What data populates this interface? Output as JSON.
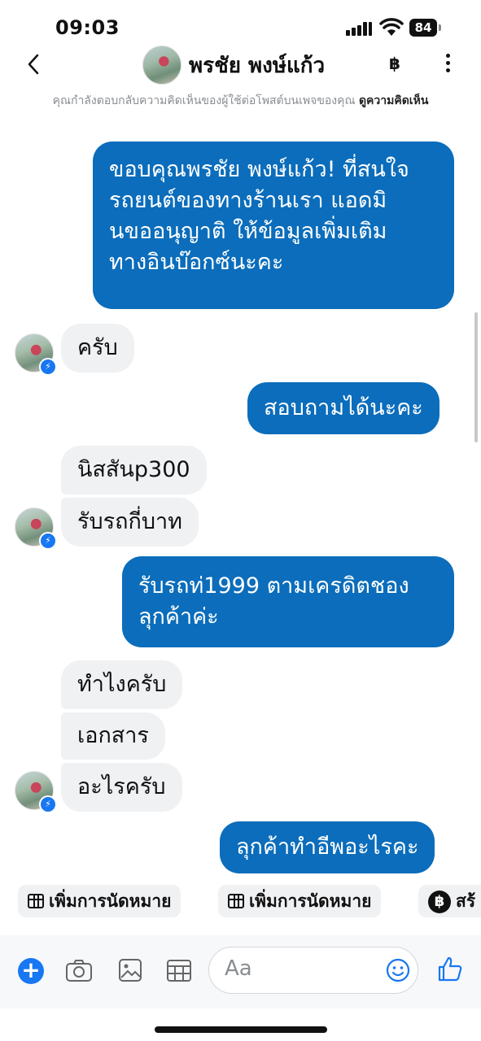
{
  "status_bar": {
    "time": "09:03",
    "battery": "84"
  },
  "header": {
    "contact_name": "พรชัย พงษ์แก้ว",
    "notice_text": "คุณกำลังตอบกลับความคิดเห็นของผู้ใช้ต่อโพสต์บนเพจของคุณ",
    "notice_link": "ดูความคิดเห็น"
  },
  "messages": [
    {
      "side": "out",
      "lines": [
        "ขอบคุณพรชัย พงษ์แก้ว! ที่สนใจ",
        "รถยนต์ของทางร้านเรา แอดมิ",
        "นขออนุญาติ ให้ข้อมูลเพิ่มเติม",
        "ทางอินบ๊อกซ์นะคะ"
      ]
    },
    {
      "side": "in",
      "text": "ครับ"
    },
    {
      "side": "out",
      "text": "สอบถามได้นะคะ"
    },
    {
      "side": "in",
      "text": "นิสสันp300"
    },
    {
      "side": "in",
      "text": "รับรถกี่บาท"
    },
    {
      "side": "out",
      "lines": [
        "รับรถท่1999 ตามเครดิตชอง",
        "ลุกค้าค่ะ"
      ]
    },
    {
      "side": "in",
      "text": "ทำไงครับ"
    },
    {
      "side": "in",
      "text": "เอกสาร"
    },
    {
      "side": "in",
      "text": "อะไรครับ"
    },
    {
      "side": "out",
      "text": "ลุกค้าทำอีพอะไรคะ"
    }
  ],
  "quick_replies": [
    {
      "label": "เพิ่มการนัดหมาย",
      "icon": "calendar-icon"
    },
    {
      "label": "เพิ่มการนัดหมาย",
      "icon": "calendar-icon"
    },
    {
      "label": "สร้",
      "icon": "baht-icon"
    }
  ],
  "composer": {
    "placeholder": "Aa"
  },
  "colors": {
    "outgoing": "#0b6dbb",
    "incoming": "#f0f1f3",
    "accent": "#1877f2"
  }
}
